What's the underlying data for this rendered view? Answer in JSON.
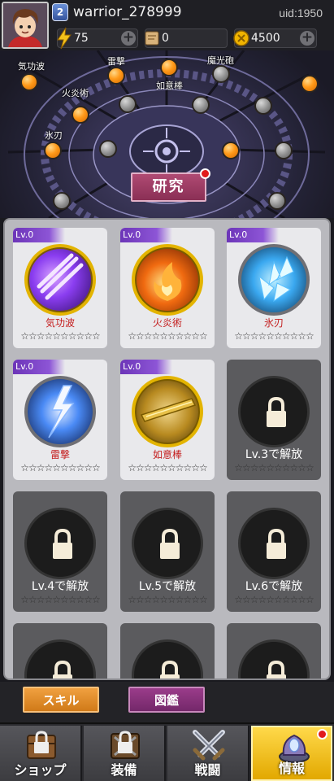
{
  "header": {
    "level": "2",
    "username": "warrior_278999",
    "uid": "uid:1950",
    "resources": [
      {
        "icon": "lightning-icon",
        "value": "75",
        "color": "#f3c21a"
      },
      {
        "icon": "scroll-icon",
        "value": "0",
        "color": "#c9a36a"
      },
      {
        "icon": "coin-icon",
        "value": "4500",
        "color": "#f0b400"
      }
    ]
  },
  "tree": {
    "labels": [
      "気功波",
      "雷撃",
      "魔光砲",
      "火炎術",
      "如意棒",
      "氷刃"
    ],
    "research_button": "研究"
  },
  "skills": [
    {
      "level": "Lv.0",
      "name": "気功波",
      "stars": "☆☆☆☆☆☆☆☆☆☆",
      "icon": "energy-wave-icon",
      "color": "#8a3df0"
    },
    {
      "level": "Lv.0",
      "name": "火炎術",
      "stars": "☆☆☆☆☆☆☆☆☆☆",
      "icon": "fire-icon",
      "color": "#f06a10"
    },
    {
      "level": "Lv.0",
      "name": "氷刃",
      "stars": "☆☆☆☆☆☆☆☆☆☆",
      "icon": "ice-blade-icon",
      "color": "#3aa8f0"
    },
    {
      "level": "Lv.0",
      "name": "雷撃",
      "stars": "☆☆☆☆☆☆☆☆☆☆",
      "icon": "lightning-strike-icon",
      "color": "#4a8af5"
    },
    {
      "level": "Lv.0",
      "name": "如意棒",
      "stars": "☆☆☆☆☆☆☆☆☆☆",
      "icon": "staff-icon",
      "color": "#d4a020"
    }
  ],
  "locked": [
    {
      "name": "Lv.3で解放",
      "stars": "☆☆☆☆☆☆☆☆☆☆"
    },
    {
      "name": "Lv.4で解放",
      "stars": "☆☆☆☆☆☆☆☆☆☆"
    },
    {
      "name": "Lv.5で解放",
      "stars": "☆☆☆☆☆☆☆☆☆☆"
    },
    {
      "name": "Lv.6で解放",
      "stars": "☆☆☆☆☆☆☆☆☆☆"
    }
  ],
  "subtabs": {
    "skill": "スキル",
    "encyclopedia": "図鑑"
  },
  "nav": {
    "shop": "ショップ",
    "equipment": "装備",
    "battle": "戦闘",
    "info": "情報"
  }
}
